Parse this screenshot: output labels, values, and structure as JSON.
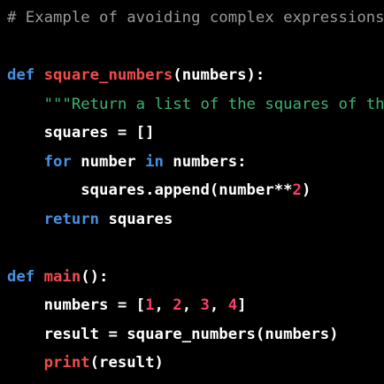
{
  "colors": {
    "background": "#000000",
    "default": "#ffffff",
    "comment": "#9a9a9a",
    "keyword": "#4a90e2",
    "function_def": "#f14c4c",
    "string": "#3cb371",
    "number": "#ff3d6b",
    "builtin": "#f14c4c"
  },
  "lines": [
    [
      {
        "t": "# Example of avoiding complex expressions",
        "k": "comment"
      }
    ],
    [],
    [
      {
        "t": "def",
        "k": "keyword"
      },
      {
        "t": " ",
        "k": "default"
      },
      {
        "t": "square_numbers",
        "k": "function_def"
      },
      {
        "t": "(numbers):",
        "k": "default"
      }
    ],
    [
      {
        "t": "    ",
        "k": "default"
      },
      {
        "t": "\"\"\"Return a list of the squares of the",
        "k": "string"
      }
    ],
    [
      {
        "t": "    squares = []",
        "k": "default"
      }
    ],
    [
      {
        "t": "    ",
        "k": "default"
      },
      {
        "t": "for",
        "k": "keyword"
      },
      {
        "t": " number ",
        "k": "default"
      },
      {
        "t": "in",
        "k": "keyword"
      },
      {
        "t": " numbers:",
        "k": "default"
      }
    ],
    [
      {
        "t": "        squares.append(number**",
        "k": "default"
      },
      {
        "t": "2",
        "k": "number"
      },
      {
        "t": ")",
        "k": "default"
      }
    ],
    [
      {
        "t": "    ",
        "k": "default"
      },
      {
        "t": "return",
        "k": "keyword"
      },
      {
        "t": " squares",
        "k": "default"
      }
    ],
    [],
    [
      {
        "t": "def",
        "k": "keyword"
      },
      {
        "t": " ",
        "k": "default"
      },
      {
        "t": "main",
        "k": "function_def"
      },
      {
        "t": "():",
        "k": "default"
      }
    ],
    [
      {
        "t": "    numbers = [",
        "k": "default"
      },
      {
        "t": "1",
        "k": "number"
      },
      {
        "t": ", ",
        "k": "default"
      },
      {
        "t": "2",
        "k": "number"
      },
      {
        "t": ", ",
        "k": "default"
      },
      {
        "t": "3",
        "k": "number"
      },
      {
        "t": ", ",
        "k": "default"
      },
      {
        "t": "4",
        "k": "number"
      },
      {
        "t": "]",
        "k": "default"
      }
    ],
    [
      {
        "t": "    result = square_numbers(numbers)",
        "k": "default"
      }
    ],
    [
      {
        "t": "    ",
        "k": "default"
      },
      {
        "t": "print",
        "k": "builtin"
      },
      {
        "t": "(result)",
        "k": "default"
      }
    ]
  ]
}
